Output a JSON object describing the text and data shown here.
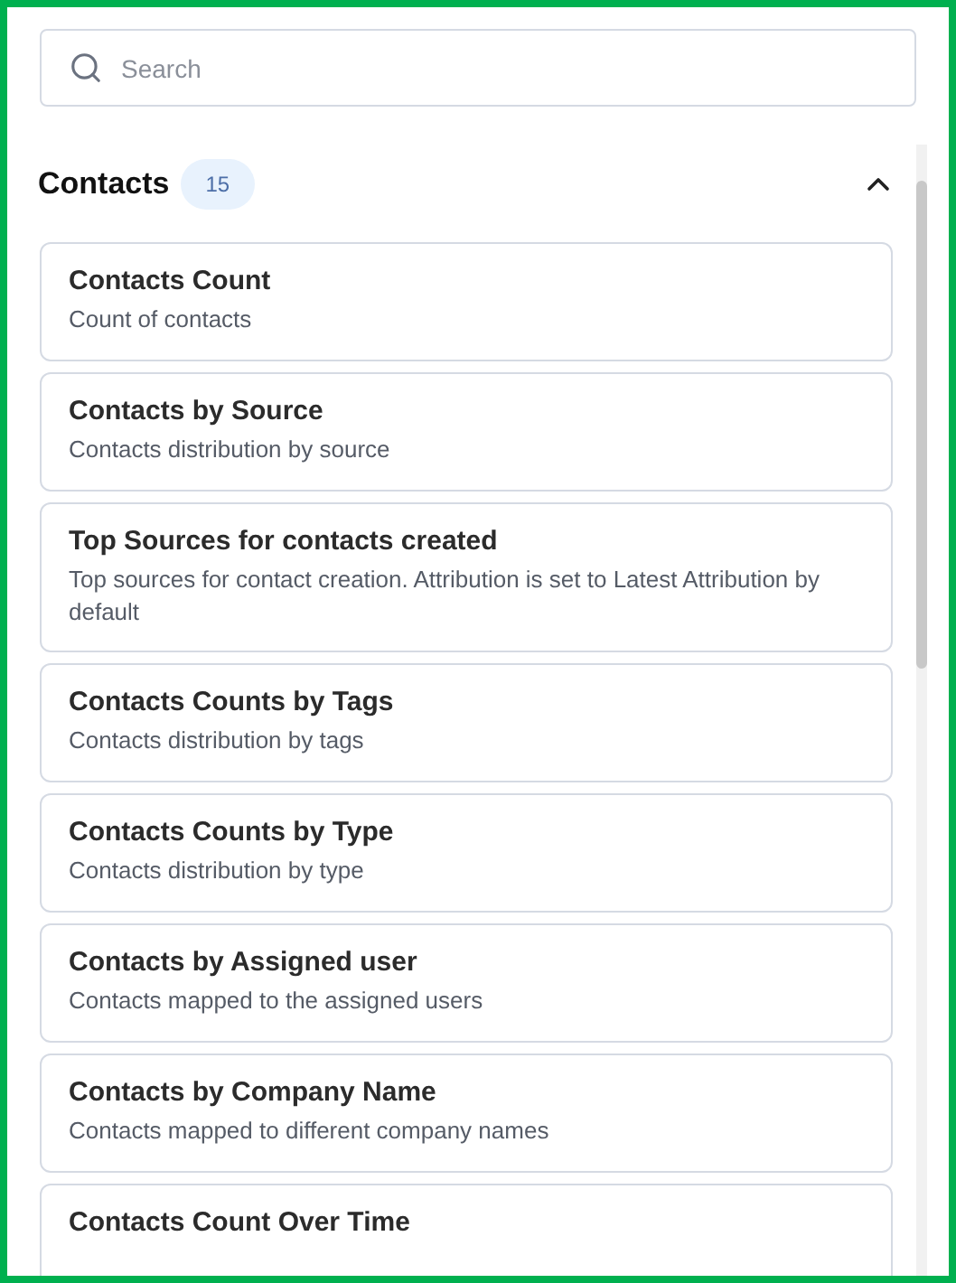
{
  "search": {
    "placeholder": "Search"
  },
  "section": {
    "title": "Contacts",
    "count": "15",
    "expanded": true
  },
  "cards": [
    {
      "title": "Contacts Count",
      "description": "Count of contacts"
    },
    {
      "title": "Contacts by Source",
      "description": "Contacts distribution by source"
    },
    {
      "title": "Top Sources for contacts created",
      "description": "Top sources for contact creation. Attribution is set to Latest Attribution by default"
    },
    {
      "title": "Contacts Counts by Tags",
      "description": "Contacts distribution by tags"
    },
    {
      "title": "Contacts Counts by Type",
      "description": "Contacts distribution by type"
    },
    {
      "title": "Contacts by Assigned user",
      "description": "Contacts mapped to the assigned users"
    },
    {
      "title": "Contacts by Company Name",
      "description": "Contacts mapped to different company names"
    },
    {
      "title": "Contacts Count Over Time"
    }
  ]
}
